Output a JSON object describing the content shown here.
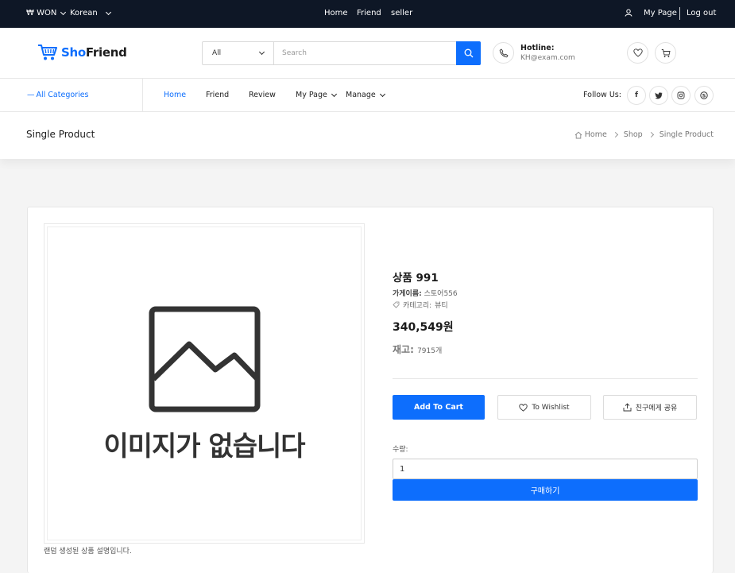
{
  "topbar": {
    "currency": "₩ WON",
    "language": "Korean",
    "links": [
      "Home",
      "Friend",
      "seller"
    ],
    "mypage": "My Page",
    "logout": "Log out"
  },
  "header": {
    "logo_prefix": "Sho",
    "logo_suffix": "Friend",
    "search_category": "All",
    "search_placeholder": "Search",
    "hotline_title": "Hotline:",
    "hotline_value": "KH@exam.com"
  },
  "nav": {
    "all_categories": "All Categories",
    "items": [
      "Home",
      "Friend",
      "Review",
      "My Page",
      "Manage"
    ],
    "follow_us": "Follow Us:",
    "social": [
      "f",
      "t",
      "ig",
      "s"
    ]
  },
  "pagebar": {
    "title": "Single Product",
    "breadcrumb": [
      "Home",
      "Shop",
      "Single Product"
    ]
  },
  "product": {
    "no_image_text": "이미지가 없습니다",
    "description": "랜덤 생성된 상품 설명입니다.",
    "name": "상품 991",
    "store_label": "가게이름:",
    "store_name": "스토어556",
    "category_label": "카테고리:",
    "category_name": "뷰티",
    "price": "340,549원",
    "stock_label": "재고:",
    "stock_value": "7915개",
    "add_to_cart": "Add To Cart",
    "wishlist": "To Wishlist",
    "share": "친구에게 공유",
    "qty_label": "수량:",
    "qty_value": "1",
    "buy": "구매하기"
  },
  "colors": {
    "primary": "#0d6efd",
    "topbar": "#0e1726"
  }
}
